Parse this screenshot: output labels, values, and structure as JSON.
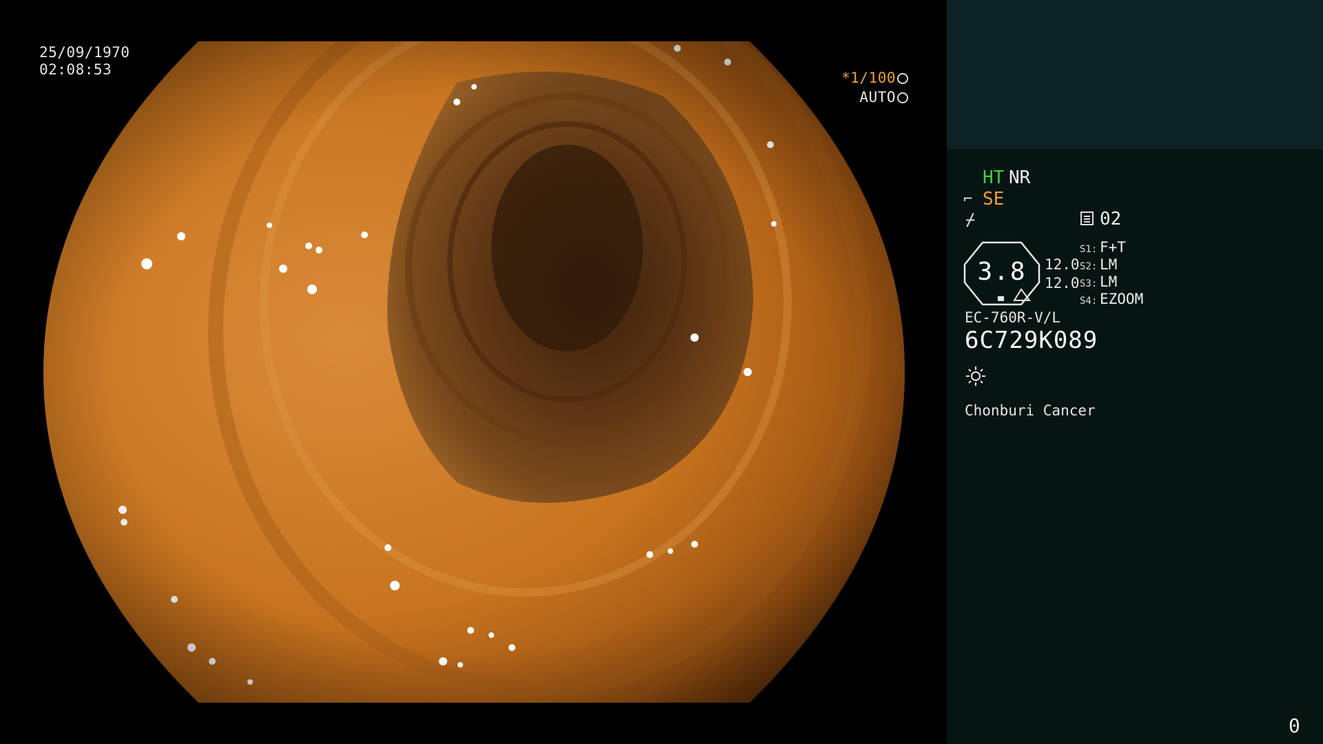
{
  "overlay": {
    "date": "25/09/1970",
    "time": "02:08:53",
    "shutter_ratio": "*1/100",
    "auto_label": "AUTO",
    "shutter_icon": "aperture-icon",
    "auto_icon": "iris-icon"
  },
  "panel": {
    "ht": "HT",
    "nr": "NR",
    "se": "SE",
    "se_icon": "structure-enhance-icon",
    "curve_icon": "tone-curve-icon",
    "mode_icon": "mode-list-icon",
    "mode_number": "02",
    "zoom_value": "3.8",
    "value_top": "12.0",
    "value_bottom": "12.0",
    "switches": [
      {
        "label": "S1:",
        "value": "F+T"
      },
      {
        "label": "S2:",
        "value": "LM"
      },
      {
        "label": "S3:",
        "value": "LM"
      },
      {
        "label": "S4:",
        "value": "EZOOM"
      }
    ],
    "scope_model": "EC-760R-V/L",
    "scope_serial": "6C729K089",
    "light_icon": "light-source-icon",
    "hospital": "Chonburi Cancer",
    "counter": "0"
  },
  "colors": {
    "ht_green": "#3fd23f",
    "se_orange": "#f0a030",
    "panel_bg": "#061412",
    "panel_top_bg": "#0d2224"
  }
}
